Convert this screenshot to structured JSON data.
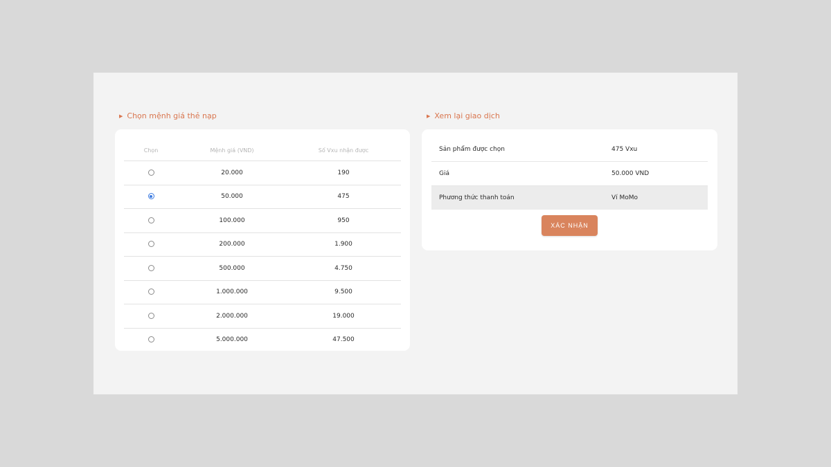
{
  "left_section": {
    "title": "Chọn mệnh giá thẻ nạp",
    "table": {
      "headers": [
        "Chọn",
        "Mệnh giá (VND)",
        "Số Vxu nhận được"
      ],
      "rows": [
        {
          "price": "20.000",
          "vxu": "190",
          "selected": false
        },
        {
          "price": "50.000",
          "vxu": "475",
          "selected": true
        },
        {
          "price": "100.000",
          "vxu": "950",
          "selected": false
        },
        {
          "price": "200.000",
          "vxu": "1.900",
          "selected": false
        },
        {
          "price": "500.000",
          "vxu": "4.750",
          "selected": false
        },
        {
          "price": "1.000.000",
          "vxu": "9.500",
          "selected": false
        },
        {
          "price": "2.000.000",
          "vxu": "19.000",
          "selected": false
        },
        {
          "price": "5.000.000",
          "vxu": "47.500",
          "selected": false
        }
      ]
    }
  },
  "right_section": {
    "title": "Xem lại giao dịch",
    "review": [
      {
        "label": "Sản phẩm được chọn",
        "value": "475 Vxu"
      },
      {
        "label": "Giá",
        "value": "50.000 VND"
      },
      {
        "label": "Phương thức thanh toán",
        "value": "Ví MoMo"
      }
    ],
    "confirm_label": "XÁC NHẬN"
  },
  "colors": {
    "accent": "#d9764f",
    "button": "#d9845d",
    "radio_selected": "#3b7ae0"
  },
  "icons": {
    "section_marker": "triangle-right-icon"
  }
}
